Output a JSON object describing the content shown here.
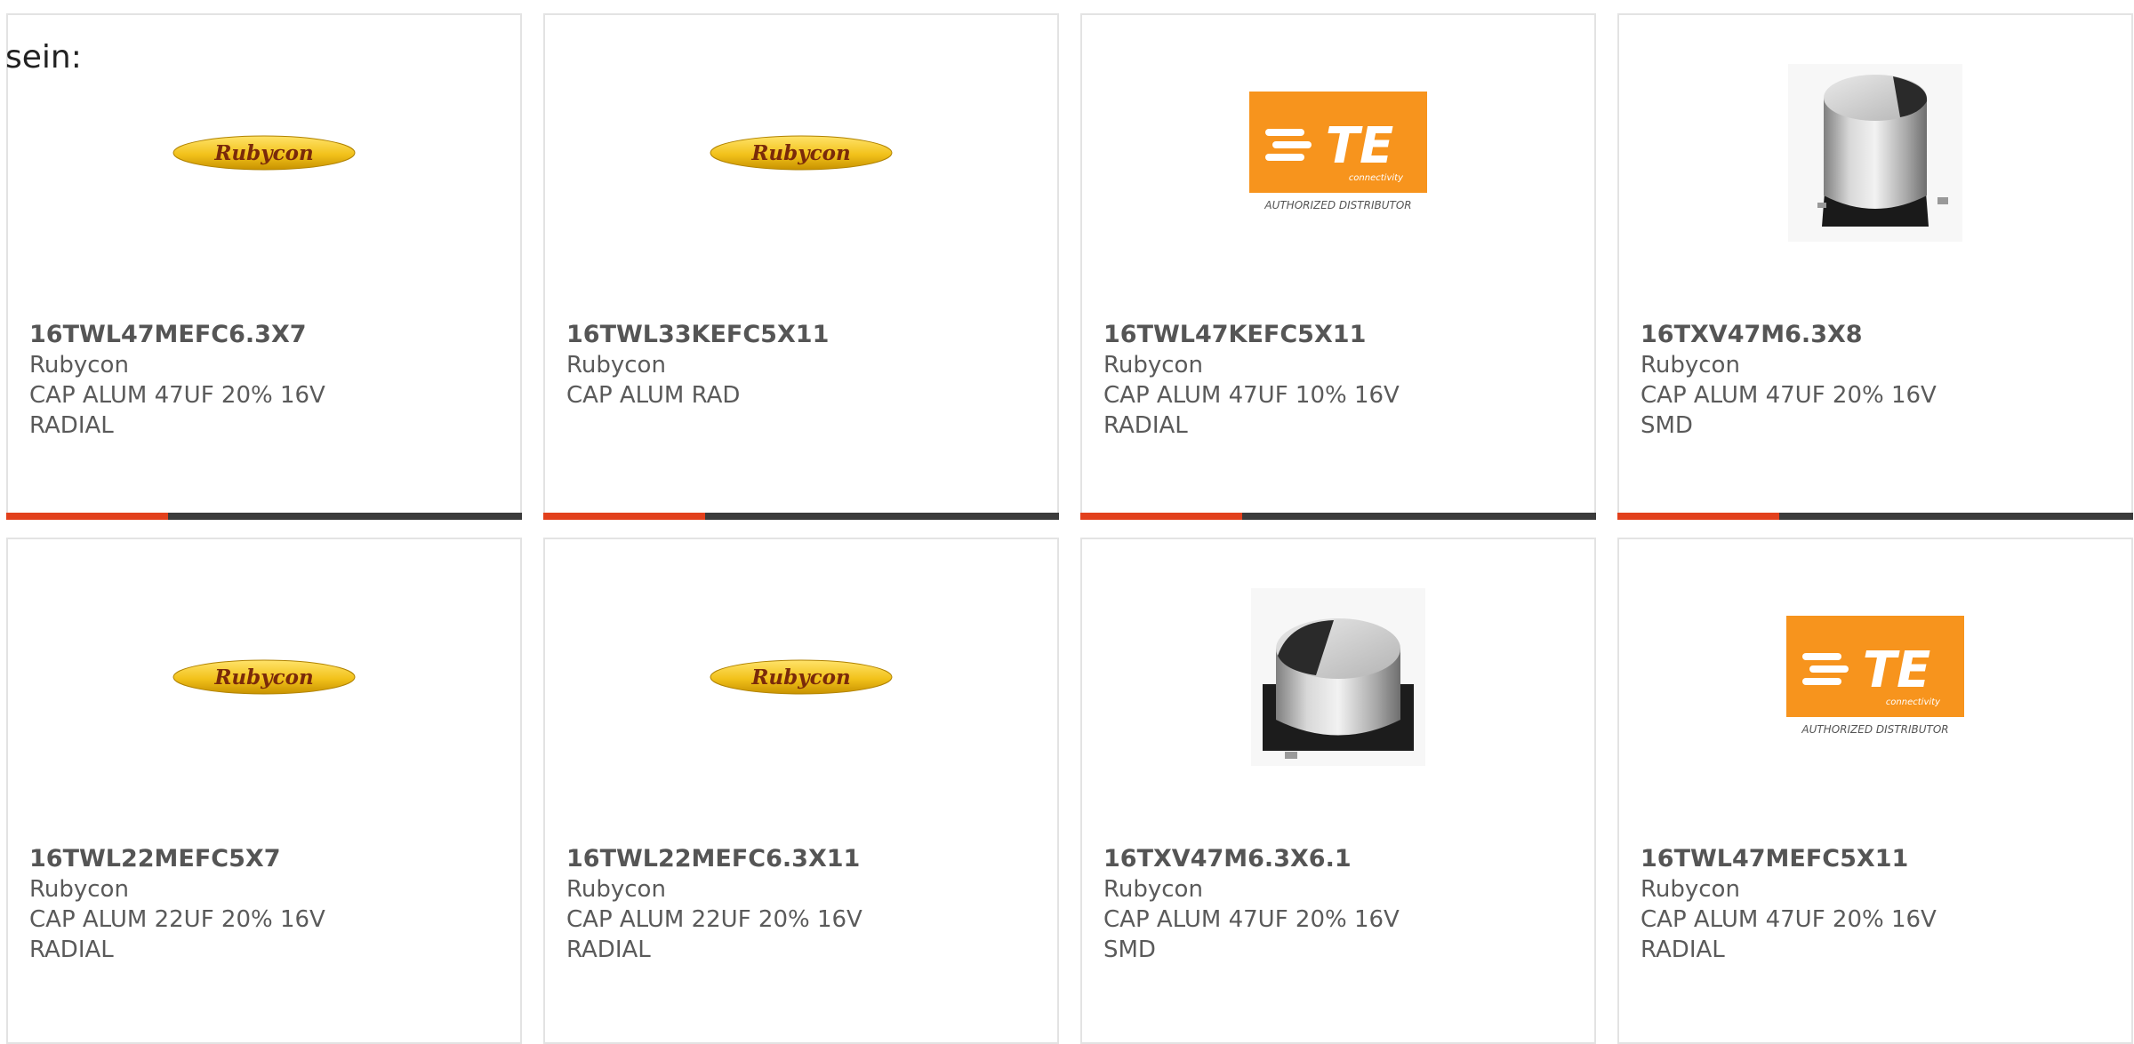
{
  "intro": "sein:",
  "colors": {
    "accent": "#e2401c",
    "bar_dark": "#3b3b3b",
    "rubycon_yellow": "#f2c21b",
    "rubycon_text": "#7a2a0a",
    "te_orange": "#f7941d"
  },
  "cards": [
    {
      "part_number": "16TWL47MEFC6.3X7",
      "manufacturer": "Rubycon",
      "description": "CAP ALUM 47UF 20% 16V RADIAL",
      "image": "rubycon-logo",
      "image_text": "Rubycon"
    },
    {
      "part_number": "16TWL33KEFC5X11",
      "manufacturer": "Rubycon",
      "description": "CAP ALUM RAD",
      "image": "rubycon-logo",
      "image_text": "Rubycon"
    },
    {
      "part_number": "16TWL47KEFC5X11",
      "manufacturer": "Rubycon",
      "description": "CAP ALUM 47UF 10% 16V RADIAL",
      "image": "te-connectivity-logo",
      "image_text": "TE",
      "image_subtext": "connectivity",
      "image_caption": "AUTHORIZED DISTRIBUTOR"
    },
    {
      "part_number": "16TXV47M6.3X8",
      "manufacturer": "Rubycon",
      "description": "CAP ALUM 47UF 20% 16V SMD",
      "image": "smd-capacitor-photo"
    },
    {
      "part_number": "16TWL22MEFC5X7",
      "manufacturer": "Rubycon",
      "description": "CAP ALUM 22UF 20% 16V RADIAL",
      "image": "rubycon-logo",
      "image_text": "Rubycon"
    },
    {
      "part_number": "16TWL22MEFC6.3X11",
      "manufacturer": "Rubycon",
      "description": "CAP ALUM 22UF 20% 16V RADIAL",
      "image": "rubycon-logo",
      "image_text": "Rubycon"
    },
    {
      "part_number": "16TXV47M6.3X6.1",
      "manufacturer": "Rubycon",
      "description": "CAP ALUM 47UF 20% 16V SMD",
      "image": "smd-capacitor-photo"
    },
    {
      "part_number": "16TWL47MEFC5X11",
      "manufacturer": "Rubycon",
      "description": "CAP ALUM 47UF 20% 16V RADIAL",
      "image": "te-connectivity-logo",
      "image_text": "TE",
      "image_subtext": "connectivity",
      "image_caption": "AUTHORIZED DISTRIBUTOR"
    }
  ]
}
